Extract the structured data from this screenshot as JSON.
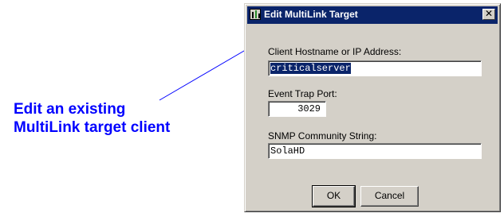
{
  "callout": {
    "line1": "Edit an existing",
    "line2": "MultiLink target client",
    "color": "#0000ff"
  },
  "dialog": {
    "title": "Edit MultiLink Target",
    "close_glyph": "✕",
    "hostname_label": "Client Hostname or IP Address:",
    "hostname_value": "criticalserver",
    "trap_port_label": "Event Trap Port:",
    "trap_port_value": "3029",
    "snmp_label": "SNMP Community String:",
    "snmp_value": "SolaHD",
    "ok_label": "OK",
    "cancel_label": "Cancel",
    "title_bar_color": "#0a246a",
    "face_color": "#d4d0c8"
  }
}
